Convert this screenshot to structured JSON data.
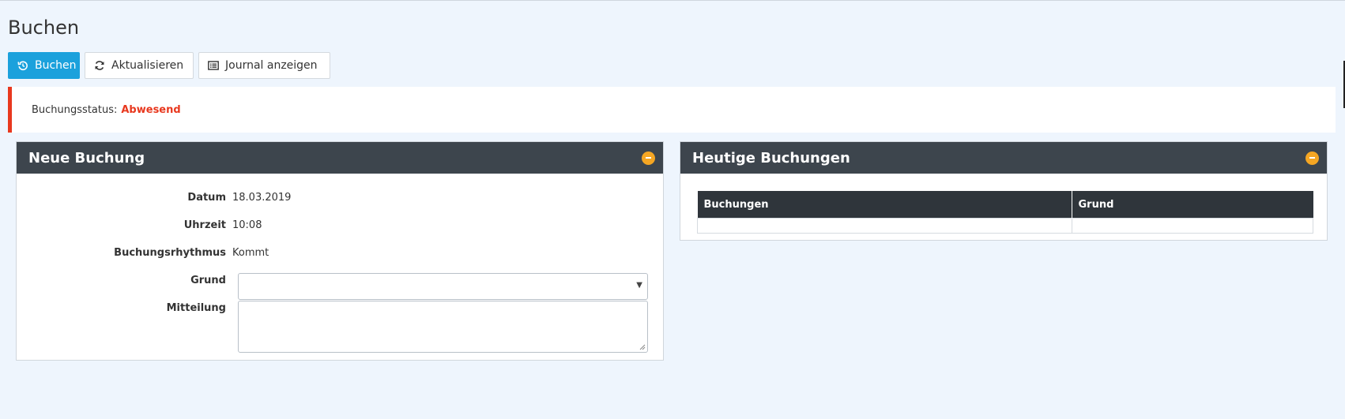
{
  "page": {
    "title": "Buchen"
  },
  "toolbar": {
    "buchen_label": "Buchen",
    "aktualisieren_label": "Aktualisieren",
    "journal_label": "Journal anzeigen"
  },
  "status": {
    "label": "Buchungsstatus:",
    "value": "Abwesend",
    "color": "#e8381e"
  },
  "new_booking": {
    "title": "Neue Buchung",
    "fields": {
      "datum_label": "Datum",
      "datum_value": "18.03.2019",
      "uhrzeit_label": "Uhrzeit",
      "uhrzeit_value": "10:08",
      "rhythmus_label": "Buchungsrhythmus",
      "rhythmus_value": "Kommt",
      "grund_label": "Grund",
      "grund_value": "",
      "mitteilung_label": "Mitteilung",
      "mitteilung_value": ""
    }
  },
  "today_bookings": {
    "title": "Heutige Buchungen",
    "columns": [
      "Buchungen",
      "Grund"
    ],
    "rows": []
  },
  "colors": {
    "primary": "#1ba1dc",
    "header": "#3d454d",
    "collapse": "#f5a623"
  },
  "icons": {
    "buchen": "history-icon",
    "aktualisieren": "refresh-icon",
    "journal": "list-alt-icon",
    "collapse": "minus-circle-icon"
  }
}
